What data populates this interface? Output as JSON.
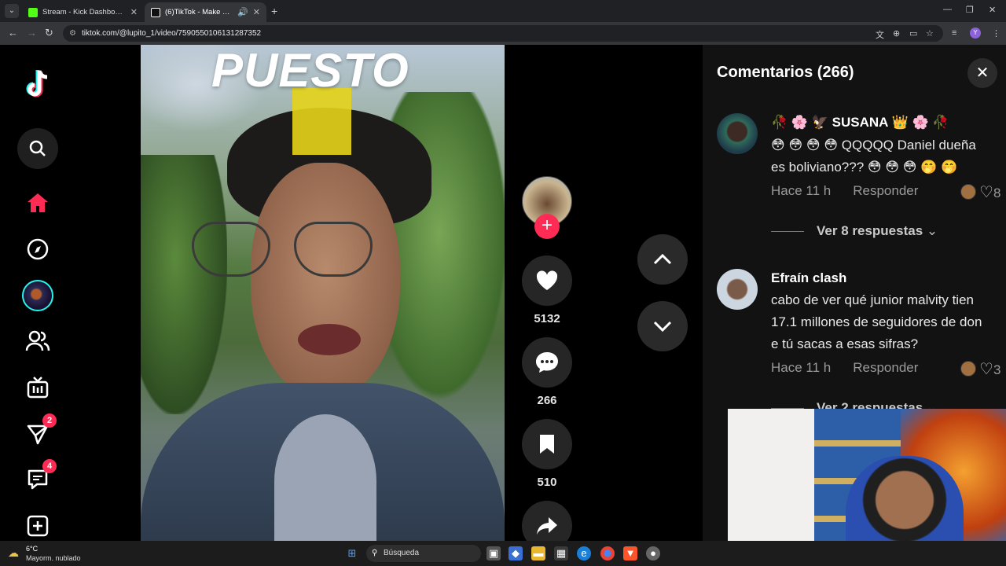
{
  "browser": {
    "tabs": [
      {
        "title": "Stream - Kick Dashboard",
        "favicon_color": "#53fc18"
      },
      {
        "title": "(6)TikTok - Make Your Day",
        "favicon_color": "#ffffff"
      }
    ],
    "url": "tiktok.com/@lupito_1/video/7590550106131287352",
    "profile_initial": "Y"
  },
  "sidebar": {
    "badges": {
      "messages": "2",
      "inbox": "4"
    }
  },
  "video": {
    "overlay_text": "PUESTO"
  },
  "actions": {
    "likes": "5132",
    "comments": "266",
    "saves": "510"
  },
  "comments_panel": {
    "title": "Comentarios (266)",
    "comments": [
      {
        "user": "🥀 🌸 🦅 SUSANA 👑 🌸 🥀",
        "text_line1": "😳 😳 😳 😳  QQQQQ Daniel dueña",
        "text_line2": "es boliviano???  😳 😳 😳 🤭 🤭",
        "time": "Hace 11 h",
        "reply": "Responder",
        "likes_partial": "8",
        "more": "Ver 8 respuestas"
      },
      {
        "user": "Efraín clash",
        "text_line1": "cabo de ver qué junior malvity tien",
        "text_line2": "17.1 millones de seguidores de don",
        "text_line3": "e tú sacas a esas sifras?",
        "time": "Hace 11 h",
        "reply": "Responder",
        "likes_partial": "3",
        "more": "Ver 2 respuestas"
      }
    ]
  },
  "taskbar": {
    "temperature": "6°C",
    "condition": "Mayorm. nublado",
    "search_label": "Búsqueda"
  },
  "colors": {
    "tiktok_red": "#fe2c55",
    "tiktok_cyan": "#25f4ee",
    "panel_bg": "#121212"
  }
}
